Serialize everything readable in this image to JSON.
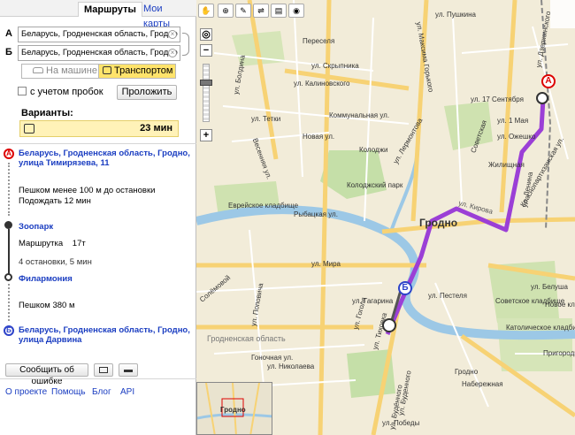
{
  "tabs": {
    "routes": "Маршруты",
    "my_maps": "Мои карты"
  },
  "from": {
    "letter": "А",
    "value": "Беларусь, Гродненская область, Гродно"
  },
  "to": {
    "letter": "Б",
    "value": "Беларусь, Гродненская область, Гродно"
  },
  "modes": {
    "car": "На машине",
    "transit": "Транспортом",
    "selected": "transit"
  },
  "traffic_checkbox": {
    "label": "с учетом пробок",
    "checked": false
  },
  "extend_button": "Проложить",
  "variants": {
    "label": "Варианты:",
    "time": "23 мин"
  },
  "route": {
    "start": {
      "letter": "А",
      "address": "Беларусь, Гродненская область, Гродно, улица Тимирязева, 11"
    },
    "walk1": "Пешком менее 100 м до остановки",
    "wait": "Подождать 12 мин",
    "stop1": "Зоопарк",
    "vehicle_type": "Маршрутка",
    "vehicle_number": "17т",
    "ride": "4 остановки, 5 мин",
    "stop2": "Филармония",
    "walk2": "Пешком 380 м",
    "end": {
      "letter": "Б",
      "address": "Беларусь, Гродненская область, Гродно, улица Дарвина"
    }
  },
  "report_error_button": "Сообщить об ошибке",
  "footer": {
    "about": "О проекте",
    "help": "Помощь",
    "blog": "Блог",
    "api": "API"
  },
  "map": {
    "city": "Гродно",
    "region": "Гродненская область",
    "route_color": "#9b3fd6",
    "streets": [
      {
        "text": "ул. Болдина"
      },
      {
        "text": "ул. Максима Горького"
      },
      {
        "text": "ул. Пушкина"
      },
      {
        "text": "ул. Дзержинского"
      },
      {
        "text": "ул. Скрыпника"
      },
      {
        "text": "ул. Калиновского"
      },
      {
        "text": "ул. Тетки"
      },
      {
        "text": "Весенняя ул."
      },
      {
        "text": "Новая ул."
      },
      {
        "text": "ул. Лермонтова"
      },
      {
        "text": "ул. 17 Сентября"
      },
      {
        "text": "Коммунальная ул."
      },
      {
        "text": "Колоджи"
      },
      {
        "text": "Рыбацкая ул."
      },
      {
        "text": "ул. Кирова"
      },
      {
        "text": "Краснопартизанская ул."
      },
      {
        "text": "ул. Мира"
      },
      {
        "text": "ул. Гагарина"
      },
      {
        "text": "Солёмовой"
      },
      {
        "text": "ул. Поповича"
      },
      {
        "text": "ул. Николаева"
      },
      {
        "text": "Гоночная ул."
      },
      {
        "text": "Пригородная"
      },
      {
        "text": "ул. Белуша"
      },
      {
        "text": "ул. 1 Мая"
      },
      {
        "text": "ул. Ожешко"
      },
      {
        "text": "Советская"
      },
      {
        "text": "Переселя"
      },
      {
        "text": "Жилищная"
      },
      {
        "text": "ул. Ленина"
      },
      {
        "text": "Колоджский парк"
      },
      {
        "text": "Еврейское кладбище"
      },
      {
        "text": "Советское кладбище"
      },
      {
        "text": "Новое кладбище"
      },
      {
        "text": "Католическое кладбище"
      },
      {
        "text": "ул. Гоголя"
      },
      {
        "text": "ул. Тиховка"
      },
      {
        "text": "ул. Буденного"
      },
      {
        "text": "ул. Будённого"
      },
      {
        "text": "ул. Победы"
      },
      {
        "text": "Набережная"
      },
      {
        "text": "ул. Пестеля"
      },
      {
        "text": "Гродно"
      }
    ],
    "markers": {
      "a": "А",
      "b": "Б"
    }
  },
  "minimap": {
    "label": "Гродно"
  }
}
